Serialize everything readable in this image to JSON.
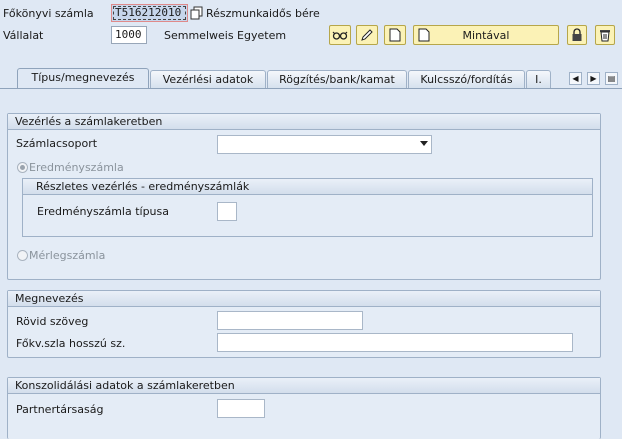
{
  "header": {
    "account_label": "Főkönyvi számla",
    "account_value": "T516212010",
    "account_desc": "Részmunkaidős bére",
    "company_label": "Vállalat",
    "company_value": "1000",
    "company_desc": "Semmelweis Egyetem"
  },
  "toolbar": {
    "template_label": "Mintával"
  },
  "tabs": [
    {
      "label": "Típus/megnevezés"
    },
    {
      "label": "Vezérlési adatok"
    },
    {
      "label": "Rögzítés/bank/kamat"
    },
    {
      "label": "Kulcsszó/fordítás"
    },
    {
      "label": "I."
    }
  ],
  "control": {
    "title": "Vezérlés a számlakeretben",
    "account_group_label": "Számlacsoport",
    "pl_label": "Eredményszámla",
    "detail_title": "Részletes vezérlés - eredményszámlák",
    "pl_type_label": "Eredményszámla típusa",
    "bs_label": "Mérlegszámla"
  },
  "description": {
    "title": "Megnevezés",
    "short_text_label": "Rövid szöveg",
    "long_text_label": "Főkv.szla hosszú sz."
  },
  "consolidation": {
    "title": "Konszolidálási adatok a számlakeretben",
    "partner_label": "Partnertársaság"
  }
}
